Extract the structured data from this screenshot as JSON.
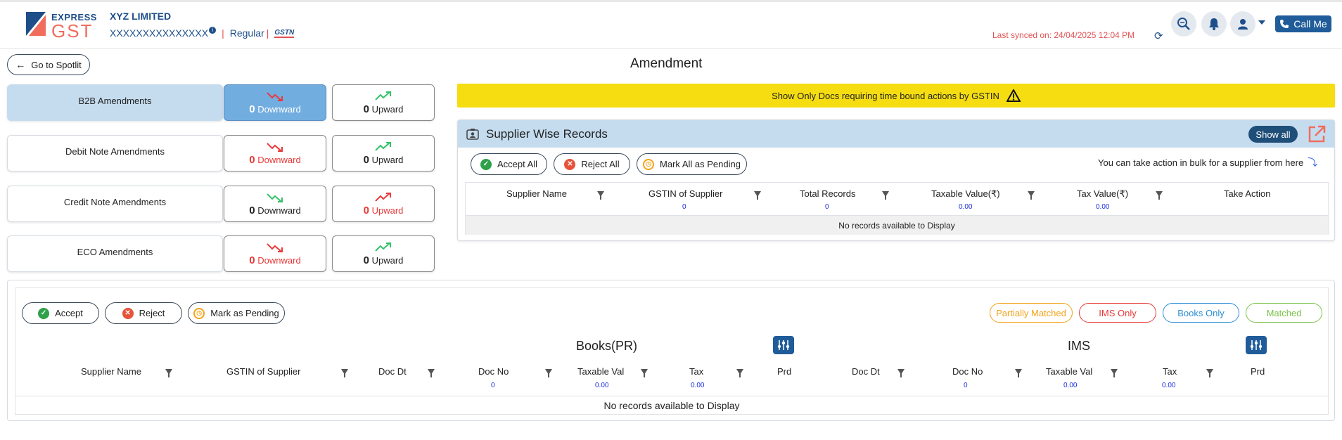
{
  "header": {
    "logo_top": "EXPRESS",
    "logo_bottom": "GST",
    "company_name": "XYZ LIMITED",
    "gstin": "XXXXXXXXXXXXXXX",
    "info_icon": "i",
    "taxpayer_type": "Regular",
    "separator": "|",
    "gstin_logo": "GSTN",
    "last_synced": "Last synced on: 24/04/2025 12:04 PM",
    "icons": [
      "refresh-icon",
      "search-zoom-icon",
      "bell-icon",
      "user-icon",
      "chevron-down-icon",
      "phone-icon"
    ],
    "call_me_label": "Call Me"
  },
  "nav": {
    "back_label": "Go to Spotlit",
    "page_title": "Amendment"
  },
  "amendments": [
    {
      "label": "B2B Amendments",
      "down_count": "0",
      "down_label": "Downward",
      "up_count": "0",
      "up_label": "Upward"
    },
    {
      "label": "Debit Note Amendments",
      "down_count": "0",
      "down_label": "Downward",
      "up_count": "0",
      "up_label": "Upward"
    },
    {
      "label": "Credit Note Amendments",
      "down_count": "0",
      "down_label": "Downward",
      "up_count": "0",
      "up_label": "Upward"
    },
    {
      "label": "ECO Amendments",
      "down_count": "0",
      "down_label": "Downward",
      "up_count": "0",
      "up_label": "Upward"
    }
  ],
  "banner": {
    "text": "Show Only Docs requiring time bound actions by GSTIN",
    "icon": "warning-icon"
  },
  "supplier_panel": {
    "title": "Supplier Wise Records",
    "show_all_label": "Show all",
    "accept_all_label": "Accept All",
    "reject_all_label": "Reject All",
    "mark_all_pending_label": "Mark All as Pending",
    "bulk_note": "You can take action in bulk for a supplier from here",
    "columns": [
      "Supplier Name",
      "GSTIN of Supplier",
      "Total Records",
      "Taxable Value(₹)",
      "Tax Value(₹)",
      "Take Action"
    ],
    "totals": {
      "total_records": "0",
      "records_count": "0",
      "taxable_value": "0.00",
      "tax_value": "0.00"
    },
    "empty_text": "No records available to Display"
  },
  "documents_panel": {
    "accept_label": "Accept",
    "reject_label": "Reject",
    "pending_label": "Mark as Pending",
    "legend": [
      {
        "label": "Partially Matched",
        "color": "#f2a31a"
      },
      {
        "label": "IMS Only",
        "color": "#e83a3a"
      },
      {
        "label": "Books Only",
        "color": "#2c8ed6"
      },
      {
        "label": "Matched",
        "color": "#7cc24a"
      }
    ],
    "books_title": "Books(PR)",
    "ims_title": "IMS",
    "columns": [
      "Supplier Name",
      "GSTIN of Supplier",
      "Doc Dt",
      "Doc No",
      "Taxable Val",
      "Tax",
      "Prd",
      "Doc Dt",
      "Doc No",
      "Taxable Val",
      "Tax",
      "Prd"
    ],
    "totals": {
      "books_doc_no": "0",
      "books_taxable": "0.00",
      "books_tax": "0.00",
      "ims_doc_no": "0",
      "ims_taxable": "0.00",
      "ims_tax": "0.00"
    },
    "empty_text": "No records available to Display"
  },
  "colors": {
    "brand_blue": "#1d4e89",
    "accent_red": "#e05353",
    "banner_yellow": "#f5dd12",
    "active_blue": "#72ade0",
    "header_tint": "#c5dcef"
  }
}
